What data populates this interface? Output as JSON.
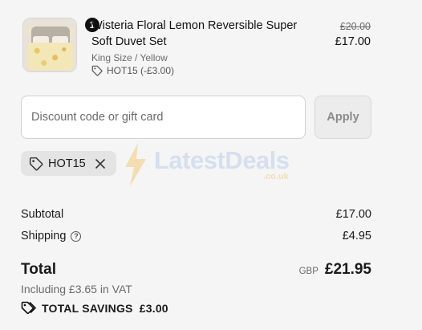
{
  "product": {
    "quantity": "1",
    "title": "Wisteria Floral Lemon Reversible Super Soft Duvet Set",
    "variant": "King Size / Yellow",
    "discount": "HOT15 (-£3.00)",
    "original_price": "£20.00",
    "price": "£17.00"
  },
  "discount_form": {
    "placeholder": "Discount code or gift card",
    "apply_label": "Apply"
  },
  "applied_code": {
    "code": "HOT15"
  },
  "watermark": {
    "brand": "LatestDeals",
    "domain": ".co.uk"
  },
  "summary": {
    "subtotal_label": "Subtotal",
    "subtotal_value": "£17.00",
    "shipping_label": "Shipping",
    "shipping_value": "£4.95",
    "total_label": "Total",
    "currency": "GBP",
    "total_value": "£21.95",
    "vat_text": "Including £3.65 in VAT",
    "savings_text": "TOTAL SAVINGS  £3.00"
  },
  "colors": {
    "background": "#f5f5f5",
    "text": "#1a1a1a",
    "muted": "#6b6b6b",
    "badge": "#111111"
  },
  "icons": [
    "tag-icon",
    "close-icon",
    "help-icon",
    "savings-tag-icon",
    "lightning-icon"
  ]
}
